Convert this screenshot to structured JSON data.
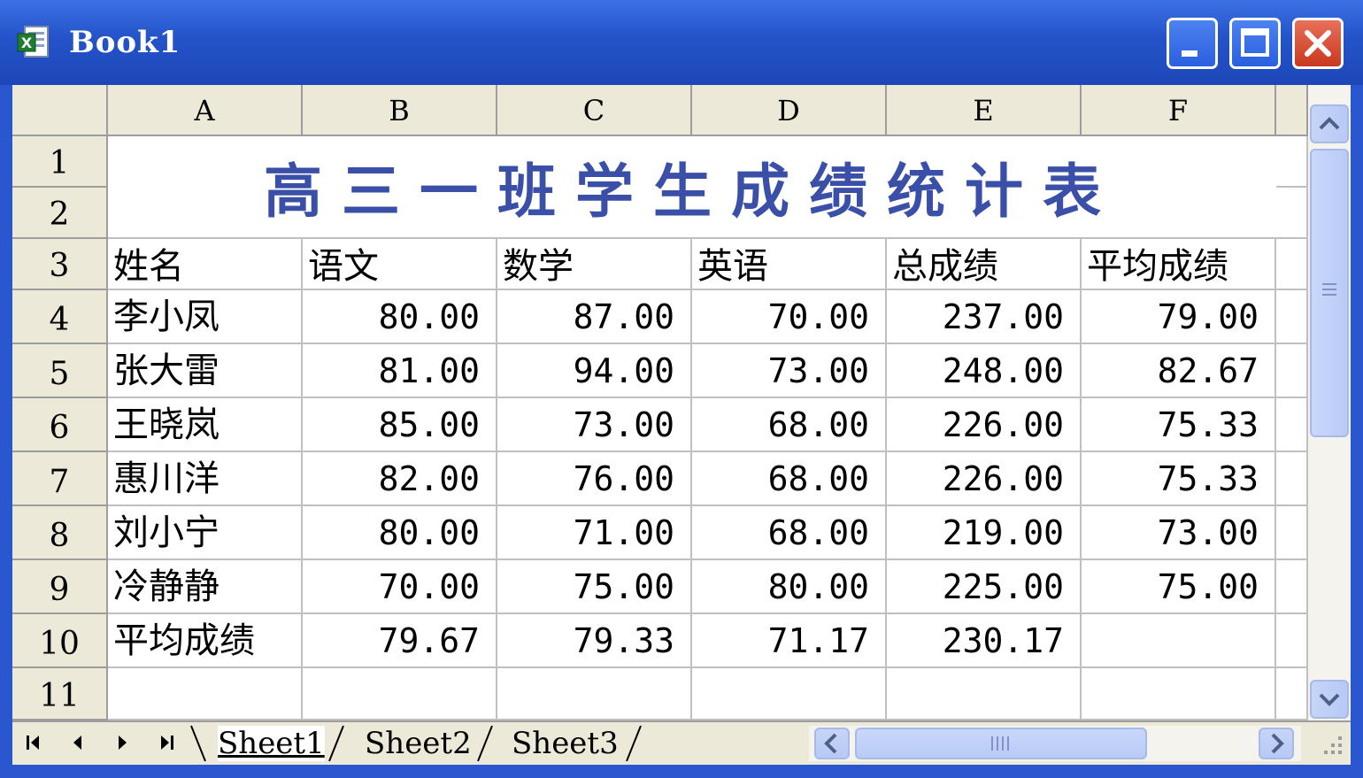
{
  "window": {
    "title": "Book1"
  },
  "columns": [
    "A",
    "B",
    "C",
    "D",
    "E",
    "F"
  ],
  "rows": [
    "1",
    "2",
    "3",
    "4",
    "5",
    "6",
    "7",
    "8",
    "9",
    "10",
    "11"
  ],
  "sheet_title": "高三一班学生成绩统计表",
  "header_row": [
    "姓名",
    "语文",
    "数学",
    "英语",
    "总成绩",
    "平均成绩"
  ],
  "data_rows": [
    {
      "name": "李小凤",
      "values": [
        "80.00",
        "87.00",
        "70.00",
        "237.00",
        "79.00"
      ]
    },
    {
      "name": "张大雷",
      "values": [
        "81.00",
        "94.00",
        "73.00",
        "248.00",
        "82.67"
      ]
    },
    {
      "name": "王晓岚",
      "values": [
        "85.00",
        "73.00",
        "68.00",
        "226.00",
        "75.33"
      ]
    },
    {
      "name": "惠川洋",
      "values": [
        "82.00",
        "76.00",
        "68.00",
        "226.00",
        "75.33"
      ]
    },
    {
      "name": "刘小宁",
      "values": [
        "80.00",
        "71.00",
        "68.00",
        "219.00",
        "73.00"
      ]
    },
    {
      "name": "冷静静",
      "values": [
        "70.00",
        "75.00",
        "80.00",
        "225.00",
        "75.00"
      ]
    },
    {
      "name": "平均成绩",
      "values": [
        "79.67",
        "79.33",
        "71.17",
        "230.17",
        ""
      ]
    }
  ],
  "tabs": [
    "Sheet1",
    "Sheet2",
    "Sheet3"
  ],
  "active_tab": "Sheet1",
  "colors": {
    "title_text": "#3a4fa8",
    "header_bg": "#ece9d8",
    "titlebar": "#2453c9",
    "close_button": "#c9391e"
  },
  "icons": {
    "app": "excel-icon",
    "minimize": "minimize-icon",
    "maximize": "maximize-icon",
    "close": "close-icon",
    "nav_first": "first-sheet-icon",
    "nav_prev": "prev-sheet-icon",
    "nav_next": "next-sheet-icon",
    "nav_last": "last-sheet-icon",
    "scroll_up": "scroll-up-icon",
    "scroll_down": "scroll-down-icon",
    "scroll_left": "scroll-left-icon",
    "scroll_right": "scroll-right-icon"
  }
}
